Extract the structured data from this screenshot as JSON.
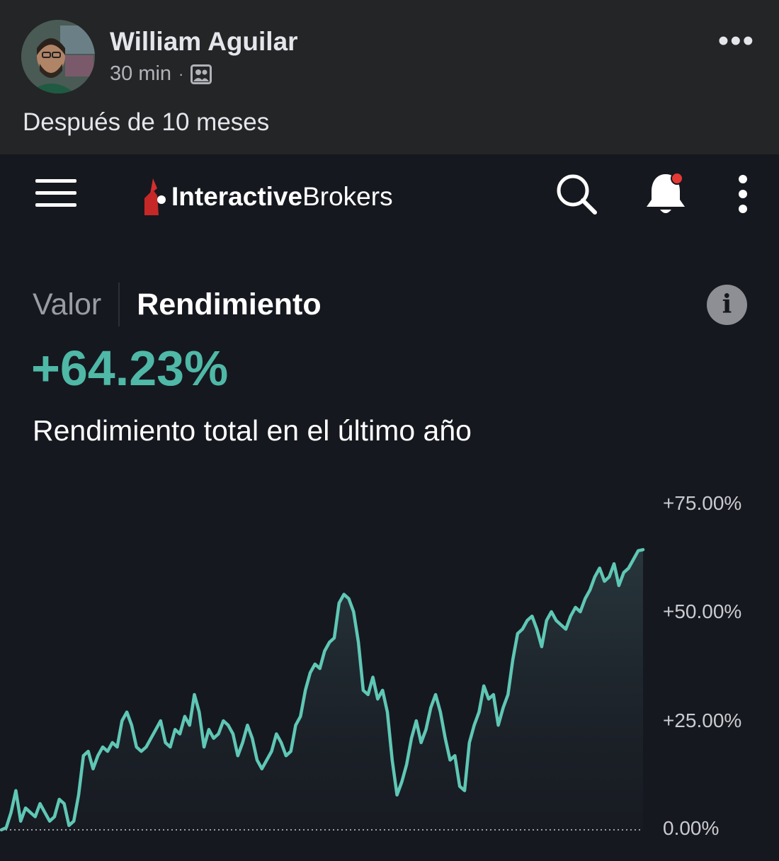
{
  "post": {
    "author": "William Aguilar",
    "time": "30 min",
    "separator": "·",
    "audience_icon": "friends-audience-icon",
    "more_icon": "more-horizontal-icon",
    "more_label": "•••",
    "caption": "Después de 10 meses"
  },
  "app": {
    "brand_bold": "Interactive",
    "brand_light": "Brokers",
    "menu_icon": "menu-icon",
    "search_icon": "search-icon",
    "bell_icon": "notification-bell-icon",
    "overflow_icon": "more-vertical-icon",
    "accent_color": "#4fb8a7",
    "notification_dot_color": "#e53935",
    "tabs": [
      {
        "label": "Valor",
        "selected": false
      },
      {
        "label": "Rendimiento",
        "selected": true
      }
    ],
    "info_label": "i",
    "performance_value": "+64.23%",
    "performance_caption": "Rendimiento total en el último año"
  },
  "chart_data": {
    "type": "area",
    "title": "",
    "xlabel": "",
    "ylabel": "",
    "ylim": [
      0,
      75
    ],
    "y_ticks": [
      "+75.00%",
      "+50.00%",
      "+25.00%",
      "0.00%"
    ],
    "y_tick_values": [
      75,
      50,
      25,
      0
    ],
    "baseline_style": "dotted",
    "grid": false,
    "line_color": "#5fc7b5",
    "series": [
      {
        "values": [
          0,
          0.5,
          4,
          9,
          2,
          5,
          4,
          3,
          6,
          4,
          2,
          3,
          7,
          6,
          1,
          2,
          8,
          17,
          18,
          14,
          17,
          19,
          18,
          20,
          19,
          25,
          27,
          24,
          19,
          18,
          19,
          21,
          23,
          25,
          20,
          19,
          23,
          22,
          26,
          24,
          31,
          27,
          19,
          23,
          21,
          22,
          25,
          24,
          22,
          17,
          20,
          24,
          21,
          16,
          14,
          16,
          18,
          22,
          20,
          17,
          18,
          24,
          26,
          32,
          36,
          38,
          37,
          41,
          43,
          44,
          52,
          54,
          53,
          50,
          43,
          32,
          31,
          35,
          30,
          32,
          27,
          16,
          8,
          11,
          15,
          21,
          25,
          20,
          23,
          28,
          31,
          27,
          21,
          16,
          17,
          10,
          9,
          20,
          24,
          27,
          33,
          30,
          31,
          24,
          28,
          31,
          39,
          45,
          46,
          48,
          49,
          46,
          42,
          48,
          50,
          48,
          47,
          46,
          49,
          51,
          50,
          53,
          55,
          58,
          60,
          57,
          58,
          61,
          56,
          59,
          60,
          62,
          64,
          64.23
        ]
      }
    ]
  }
}
